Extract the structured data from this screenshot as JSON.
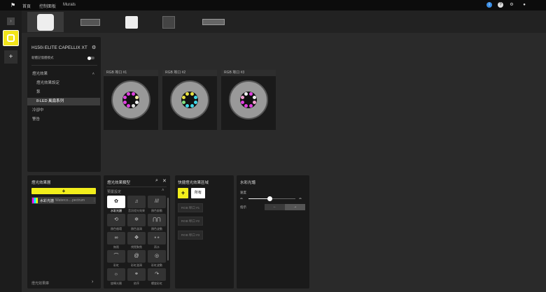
{
  "topbar": {
    "nav": [
      "首頁",
      "控制面板",
      "Murals"
    ],
    "icons": [
      "info-icon",
      "help-icon",
      "settings-icon",
      "account-icon"
    ]
  },
  "rail": {
    "expand": "›",
    "add": "+"
  },
  "devices": [
    "cooler-h150i",
    "keyboard",
    "fan",
    "hub",
    "memory"
  ],
  "device_panel": {
    "title": "H150i ELITE CAPELLIX XT",
    "memory_mode": "韌體記憶體模式",
    "menu": [
      "燈光效果",
      "燈光效果設定",
      "泵",
      "8-LED 風扇系列",
      "冷卻中",
      "警告"
    ]
  },
  "fan_cards": [
    {
      "label": "RGB 埠口 #1",
      "leds": [
        "#e040e0",
        "#e040e0",
        "#f0f0a0",
        "#f0f0f0",
        "#e0e0e0",
        "#e040e0",
        "#e040e0",
        "#e040e0"
      ]
    },
    {
      "label": "RGB 埠口 #2",
      "leds": [
        "#e8e040",
        "#e8e040",
        "#40d8e8",
        "#40d8e8",
        "#40d8e8",
        "#40d8e8",
        "#80e080",
        "#e8e040"
      ]
    },
    {
      "label": "RGB 埠口 #3",
      "leds": [
        "#f0f0f0",
        "#e040e0",
        "#f0f0f0",
        "#f0a0d0",
        "#e040e0",
        "#e040e0",
        "#e040e0",
        "#f0a0d0"
      ]
    }
  ],
  "layers": {
    "title": "燈光效果層",
    "add": "+",
    "layer_name": "水彩光譜",
    "layer_desc": "Waterco....pectrum",
    "library": "燈光效果庫",
    "library_arrow": "›"
  },
  "effect_types": {
    "title": "燈光效果類型",
    "preset": "預置設定",
    "items": [
      {
        "label": "水彩光譜",
        "icon": "✿"
      },
      {
        "label": "音訊燈光效果",
        "icon": "♫"
      },
      {
        "label": "顏色脈動",
        "icon": "///"
      },
      {
        "label": "顏色循環",
        "icon": "⟲"
      },
      {
        "label": "顏色漩渦",
        "icon": "✲"
      },
      {
        "label": "顏色波動",
        "icon": "⋂⋂"
      },
      {
        "label": "無限",
        "icon": "∞"
      },
      {
        "label": "視覺聚焦",
        "icon": "✥"
      },
      {
        "label": "雨水",
        "icon": "∘∘"
      },
      {
        "label": "彩虹",
        "icon": "⌒"
      },
      {
        "label": "彩虹漩渦",
        "icon": "@"
      },
      {
        "label": "彩虹波動",
        "icon": "◎"
      },
      {
        "label": "旋轉光圈",
        "icon": "☼"
      },
      {
        "label": "依序",
        "icon": "⚭"
      },
      {
        "label": "螺旋彩虹",
        "icon": "↷"
      }
    ]
  },
  "quick_zones": {
    "title": "快捷燈光效果區域",
    "add": "+",
    "all": "所有",
    "zones": [
      "RGB 埠口 #1",
      "RGB 埠口 #2",
      "RGB 埠口 #3"
    ]
  },
  "effect_settings": {
    "title": "水彩光譜",
    "speed_label": "速度",
    "speed_value": 0.45,
    "direction_label": "指示",
    "left": "←",
    "right": "→"
  }
}
